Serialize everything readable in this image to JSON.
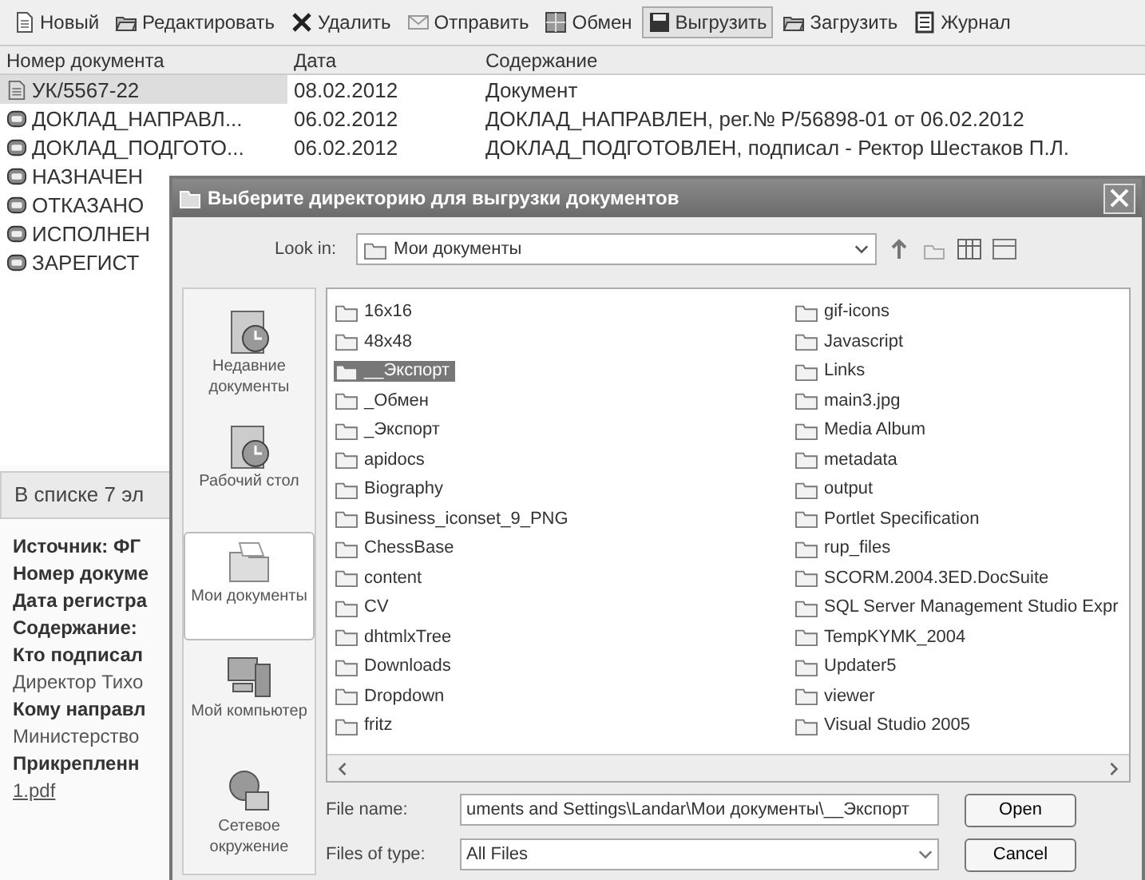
{
  "toolbar": [
    {
      "label": "Новый",
      "pressed": false
    },
    {
      "label": "Редактировать",
      "pressed": false
    },
    {
      "label": "Удалить",
      "pressed": false
    },
    {
      "label": "Отправить",
      "pressed": false
    },
    {
      "label": "Обмен",
      "pressed": false
    },
    {
      "label": "Выгрузить",
      "pressed": true
    },
    {
      "label": "Загрузить",
      "pressed": false
    },
    {
      "label": "Журнал",
      "pressed": false
    }
  ],
  "table": {
    "columns": [
      "Номер документа",
      "Дата",
      "Содержание"
    ],
    "rows": [
      {
        "kind": "document",
        "selected": true,
        "cells": [
          "УК/5567-22",
          "08.02.2012",
          "Документ"
        ]
      },
      {
        "kind": "report",
        "selected": false,
        "cells": [
          "ДОКЛАД_НАПРАВЛ...",
          "06.02.2012",
          "ДОКЛАД_НАПРАВЛЕН, рег.№ Р/56898-01 от 06.02.2012"
        ]
      },
      {
        "kind": "report",
        "selected": false,
        "cells": [
          "ДОКЛАД_ПОДГОТО...",
          "06.02.2012",
          "ДОКЛАД_ПОДГОТОВЛЕН, подписал - Ректор Шестаков П.Л."
        ]
      },
      {
        "kind": "report",
        "selected": false,
        "cells": [
          "НАЗНАЧЕН"
        ]
      },
      {
        "kind": "report",
        "selected": false,
        "cells": [
          "ОТКАЗАНО"
        ]
      },
      {
        "kind": "report",
        "selected": false,
        "cells": [
          "ИСПОЛНЕН"
        ]
      },
      {
        "kind": "report",
        "selected": false,
        "cells": [
          "ЗАРЕГИСТ"
        ]
      }
    ]
  },
  "status_bar": "В списке 7 эл",
  "details": [
    {
      "kind": "label",
      "text": "Источник: ФГ"
    },
    {
      "kind": "label",
      "text": "Номер докуме"
    },
    {
      "kind": "label",
      "text": "Дата регистра"
    },
    {
      "kind": "label",
      "text": "Содержание:"
    },
    {
      "kind": "label",
      "text": "Кто подписал"
    },
    {
      "kind": "value",
      "text": "Директор Тихо"
    },
    {
      "kind": "label",
      "text": "Кому направл"
    },
    {
      "kind": "value",
      "text": "Министерство"
    },
    {
      "kind": "label",
      "text": "Прикрепленн"
    },
    {
      "kind": "link",
      "text": "1.pdf"
    }
  ],
  "dialog": {
    "title": "Выберите директорию для выгрузки документов",
    "look_in_label": "Look in:",
    "look_in_value": "Мои документы",
    "places": [
      {
        "label": "Недавние документы",
        "selected": false
      },
      {
        "label": "Рабочий стол",
        "selected": false
      },
      {
        "label": "Мои документы",
        "selected": true
      },
      {
        "label": "Мой компьютер",
        "selected": false
      },
      {
        "label": "Сетевое окружение",
        "selected": false
      }
    ],
    "files": [
      {
        "name": "16x16",
        "selected": false
      },
      {
        "name": "48x48",
        "selected": false
      },
      {
        "name": "__Экспорт",
        "selected": true
      },
      {
        "name": "_Обмен",
        "selected": false
      },
      {
        "name": "_Экспорт",
        "selected": false
      },
      {
        "name": "apidocs",
        "selected": false
      },
      {
        "name": "Biography",
        "selected": false
      },
      {
        "name": "Business_iconset_9_PNG",
        "selected": false
      },
      {
        "name": "ChessBase",
        "selected": false
      },
      {
        "name": "content",
        "selected": false
      },
      {
        "name": "CV",
        "selected": false
      },
      {
        "name": "dhtmlxTree",
        "selected": false
      },
      {
        "name": "Downloads",
        "selected": false
      },
      {
        "name": "Dropdown",
        "selected": false
      },
      {
        "name": "fritz",
        "selected": false
      },
      {
        "name": "gif-icons",
        "selected": false
      },
      {
        "name": "Javascript",
        "selected": false
      },
      {
        "name": "Links",
        "selected": false
      },
      {
        "name": "main3.jpg",
        "selected": false
      },
      {
        "name": "Media Album",
        "selected": false
      },
      {
        "name": "metadata",
        "selected": false
      },
      {
        "name": "output",
        "selected": false
      },
      {
        "name": "Portlet Specification",
        "selected": false
      },
      {
        "name": "rup_files",
        "selected": false
      },
      {
        "name": "SCORM.2004.3ED.DocSuite",
        "selected": false
      },
      {
        "name": "SQL Server Management Studio Expr",
        "selected": false
      },
      {
        "name": "TempKYMK_2004",
        "selected": false
      },
      {
        "name": "Updater5",
        "selected": false
      },
      {
        "name": "viewer",
        "selected": false
      },
      {
        "name": "Visual Studio 2005",
        "selected": false
      }
    ],
    "file_name_label": "File name:",
    "file_name_value": "uments and Settings\\Landar\\Мои документы\\__Экспорт",
    "file_type_label": "Files of type:",
    "file_type_value": "All Files",
    "buttons": [
      "Open",
      "Cancel"
    ]
  }
}
